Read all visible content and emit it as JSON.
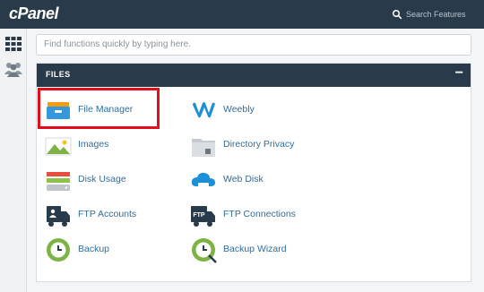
{
  "topbar": {
    "logo": "cPanel",
    "search_placeholder": "Search Features"
  },
  "quickfind": {
    "placeholder": "Find functions quickly by typing here."
  },
  "panel": {
    "title": "FILES",
    "collapse_symbol": "−"
  },
  "items": [
    {
      "label": "File Manager",
      "icon": "file-manager-icon"
    },
    {
      "label": "Weebly",
      "icon": "weebly-icon"
    },
    {
      "label": "Images",
      "icon": "images-icon"
    },
    {
      "label": "Directory Privacy",
      "icon": "directory-privacy-icon"
    },
    {
      "label": "Disk Usage",
      "icon": "disk-usage-icon"
    },
    {
      "label": "Web Disk",
      "icon": "web-disk-icon"
    },
    {
      "label": "FTP Accounts",
      "icon": "ftp-accounts-icon"
    },
    {
      "label": "FTP Connections",
      "icon": "ftp-connections-icon"
    },
    {
      "label": "Backup",
      "icon": "backup-icon"
    },
    {
      "label": "Backup Wizard",
      "icon": "backup-wizard-icon"
    }
  ],
  "icon_text": {
    "ftp": "FTP"
  },
  "colors": {
    "header": "#293a4a",
    "link": "#2d6ea3",
    "highlight": "#e30d1b"
  }
}
